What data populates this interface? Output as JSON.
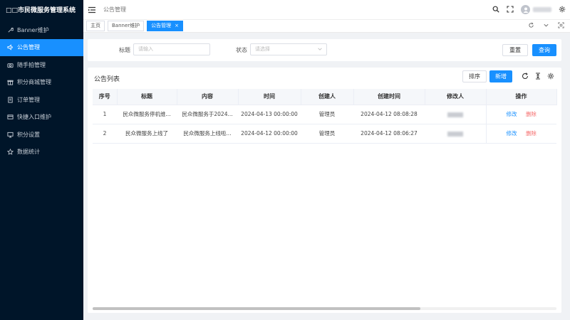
{
  "app": {
    "title": "□□市民微服务管理系统"
  },
  "sidebar": {
    "items": [
      {
        "label": "Banner维护",
        "icon": "wrench-icon",
        "active": false
      },
      {
        "label": "公告管理",
        "icon": "speaker-icon",
        "active": true
      },
      {
        "label": "随手拍管理",
        "icon": "camera-icon",
        "active": false
      },
      {
        "label": "积分商城管理",
        "icon": "gift-icon",
        "active": false
      },
      {
        "label": "订单管理",
        "icon": "document-icon",
        "active": false
      },
      {
        "label": "快捷入口维护",
        "icon": "card-icon",
        "active": false
      },
      {
        "label": "积分设置",
        "icon": "monitor-icon",
        "active": false
      },
      {
        "label": "数据统计",
        "icon": "star-icon",
        "active": false
      }
    ]
  },
  "header": {
    "breadcrumb": "公告管理"
  },
  "tabs": [
    {
      "label": "主页",
      "active": false,
      "closable": false
    },
    {
      "label": "Banner维护",
      "active": false,
      "closable": false
    },
    {
      "label": "公告管理",
      "active": true,
      "closable": true,
      "close": "×"
    }
  ],
  "search": {
    "title_label": "标题",
    "title_placeholder": "请输入",
    "status_label": "状态",
    "status_placeholder": "请选择",
    "reset_label": "重置",
    "query_label": "查询"
  },
  "list": {
    "title": "公告列表",
    "sort_label": "排序",
    "add_label": "新增",
    "columns": [
      "序号",
      "标题",
      "内容",
      "时间",
      "创建人",
      "创建时间",
      "修改人",
      "操作"
    ],
    "rows": [
      {
        "index": "1",
        "title": "民众微服务停机维...",
        "content": "民众微服务于2024...",
        "time": "2024-04-13 00:00:00",
        "creator": "管理员",
        "created_at": "2024-04-12 08:08:28",
        "edit_label": "修改",
        "delete_label": "删除"
      },
      {
        "index": "2",
        "title": "民众微服务上线了",
        "content": "民众微服务上线啦...",
        "time": "2024-04-12 00:00:00",
        "creator": "管理员",
        "created_at": "2024-04-12 08:06:27",
        "edit_label": "修改",
        "delete_label": "删除"
      }
    ]
  },
  "colors": {
    "sidebar_bg": "#001529",
    "primary": "#1890ff",
    "danger": "#f56c6c"
  }
}
